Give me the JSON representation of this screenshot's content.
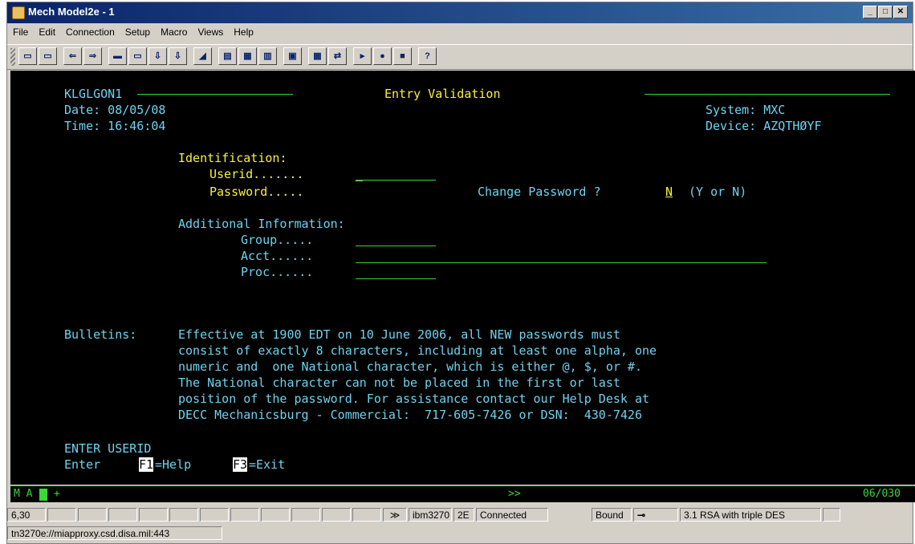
{
  "window": {
    "title": "Mech Model2e - 1"
  },
  "menu": [
    "File",
    "Edit",
    "Connection",
    "Setup",
    "Macro",
    "Views",
    "Help"
  ],
  "toolbar": [
    "disconnect-icon",
    "screen-icon",
    "back-arrow-icon",
    "forward-arrow-icon",
    "save-icon",
    "print-icon",
    "copy-icon",
    "paste-icon",
    "erase-icon",
    "keyboard-icon",
    "map-icon",
    "keypad-icon",
    "lock-icon",
    "grid-icon",
    "transfer-icon",
    "play-icon",
    "record-icon",
    "stop-icon",
    "help-icon"
  ],
  "toolbar_glyphs": [
    "▭",
    "▭",
    "⇐",
    "⇒",
    "▬",
    "▭",
    "⇩",
    "⇩",
    "◢",
    "▤",
    "▦",
    "▥",
    "▣",
    "▦",
    "⇄",
    "▸",
    "●",
    "■",
    "?"
  ],
  "terminal": {
    "screen_id": "KLGLGON1",
    "title": "Entry Validation",
    "date": "Date: 08/05/08",
    "time": "Time: 16:46:04",
    "system": "System: MXC",
    "device": "Device: AZQTHØYF",
    "identification_label": "Identification:",
    "userid_label": "Userid.......",
    "userid_value": "_",
    "password_label": "Password.....",
    "change_password_label": "Change Password ?",
    "change_password_value": "N",
    "change_password_hint": "(Y or N)",
    "additional_label": "Additional Information:",
    "group_label": "Group.....",
    "acct_label": "Acct......",
    "proc_label": "Proc......",
    "bulletins_label": "Bulletins:",
    "bulletins": [
      "Effective at 1900 EDT on 10 June 2006, all NEW passwords must",
      "consist of exactly 8 characters, including at least one alpha, one",
      "numeric and  one National character, which is either @, $, or #.",
      "The National character can not be placed in the first or last",
      "position of the password. For assistance contact our Help Desk at",
      "DECC Mechanicsburg - Commercial:  717-605-7426 or DSN:  430-7426"
    ],
    "message": "ENTER USERID",
    "enter_label": "Enter",
    "f1_key": "F1",
    "f1_text": "=Help",
    "f3_key": "F3",
    "f3_text": "=Exit"
  },
  "oia": {
    "left": "M A",
    "plus": "+",
    "middle": ">>",
    "cursor_pos": "06/030"
  },
  "statusbar": {
    "position": "6,30",
    "arrows": "≫",
    "terminal_type": "ibm3270",
    "model": "2E",
    "state": "Connected",
    "bound": "Bound",
    "encryption": "3.1 RSA with triple DES",
    "url": "tn3270e://miapproxy.csd.disa.mil:443"
  }
}
